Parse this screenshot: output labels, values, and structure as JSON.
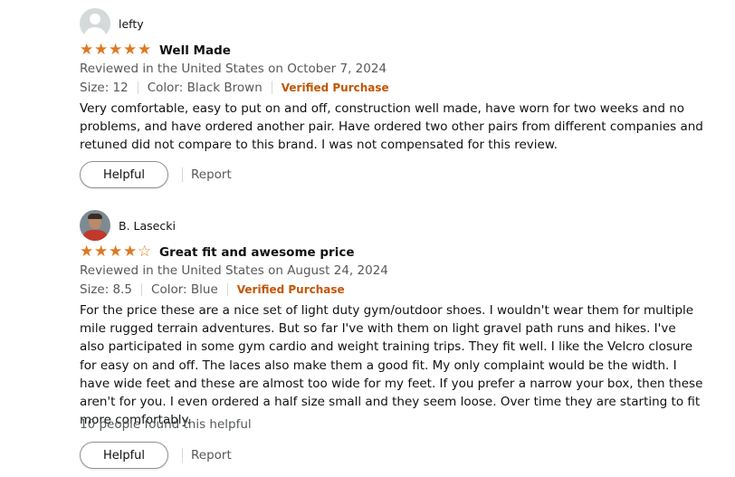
{
  "reviews": [
    {
      "reviewer": "lefty",
      "rating": 5,
      "rating_max": 5,
      "title": "Well Made",
      "date": "Reviewed in the United States on October 7, 2024",
      "size": "Size: 12",
      "color": "Color: Black Brown",
      "verified": "Verified Purchase",
      "body": "Very comfortable, easy to put on and off, construction well made, have worn for two weeks and no problems, and have ordered another pair. Have ordered two other pairs from different companies and retuned did not compare to this brand. I was not compensated for this review.",
      "helpful_label": "Helpful",
      "report_label": "Report"
    },
    {
      "reviewer": "B. Lasecki",
      "rating": 4,
      "rating_max": 5,
      "title": "Great fit and awesome price",
      "date": "Reviewed in the United States on August 24, 2024",
      "size": "Size: 8.5",
      "color": "Color: Blue",
      "verified": "Verified Purchase",
      "body": "For the price these are a nice set of light duty gym/outdoor shoes. I wouldn't wear them for multiple mile rugged terrain adventures. But so far I've with them on light gravel path runs and hikes. I've also participated in some gym cardio and weight training trips. They fit well. I like the Velcro closure for easy on and off. The laces also make them a good fit. My only complaint would be the width. I have wide feet and these are almost too wide for my feet. If you prefer a narrow your box, then these aren't for you. I even ordered a half size small and they seem loose. Over time they are starting to fit more comfortably.",
      "helpful_count": "10 people found this helpful",
      "helpful_label": "Helpful",
      "report_label": "Report"
    }
  ],
  "colors": {
    "star": "#de7921",
    "verified": "#c45500",
    "secondary_text": "#565959"
  },
  "icons": {
    "avatar_1": "default-profile-icon",
    "avatar_2": "profile-photo",
    "star_filled": "star-filled-icon",
    "star_empty": "star-outline-icon"
  }
}
